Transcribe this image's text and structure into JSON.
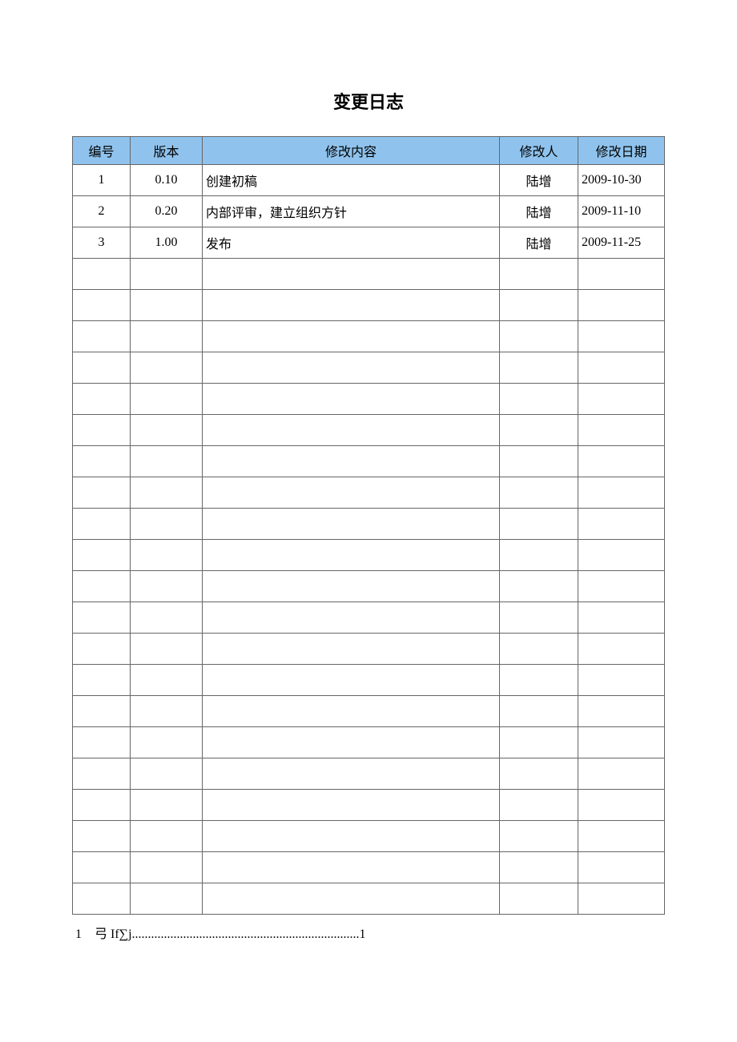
{
  "title": "变更日志",
  "headers": {
    "id": "编号",
    "version": "版本",
    "content": "修改内容",
    "person": "修改人",
    "date": "修改日期"
  },
  "chart_data": {
    "type": "table",
    "columns": [
      "编号",
      "版本",
      "修改内容",
      "修改人",
      "修改日期"
    ],
    "rows": [
      {
        "id": "1",
        "version": "0.10",
        "content": "创建初稿",
        "person": "陆增",
        "date": "2009-10-30"
      },
      {
        "id": "2",
        "version": "0.20",
        "content": "内部评审，建立组织方针",
        "person": "陆增",
        "date": "2009-11-10"
      },
      {
        "id": "3",
        "version": "1.00",
        "content": "发布",
        "person": "陆增",
        "date": "2009-11-25"
      }
    ],
    "empty_rows": 21
  },
  "footer": "1　弓 If∑j.......................................................................1"
}
